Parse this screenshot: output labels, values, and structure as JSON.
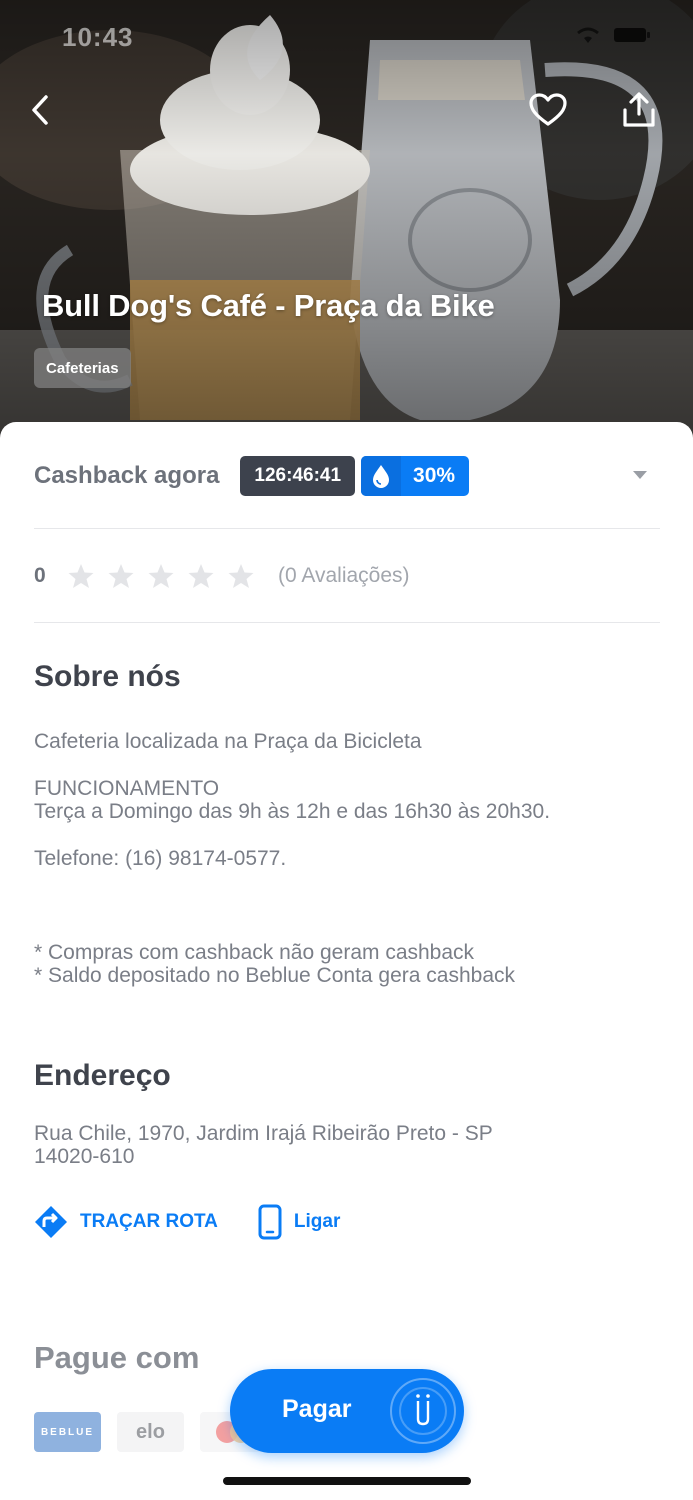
{
  "status_bar": {
    "time": "10:43"
  },
  "header": {
    "back_icon": "chevron-left-icon",
    "favorite_icon": "heart-outline-icon",
    "share_icon": "share-upload-icon",
    "title": "Bull Dog's Café - Praça da Bike",
    "category": "Cafeterias"
  },
  "cashback": {
    "label": "Cashback agora",
    "timer": "126:46:41",
    "percent": "30%",
    "drop_icon": "water-drop-icon",
    "expand_icon": "caret-down-icon"
  },
  "rating": {
    "value": "0",
    "stars_filled": 0,
    "stars_total": 5,
    "reviews": "(0 Avaliações)"
  },
  "about": {
    "title": "Sobre nós",
    "description": "Cafeteria localizada na Praça da Bicicleta",
    "hours": "FUNCIONAMENTO\nTerça a Domingo das 9h às 12h e das 16h30 às 20h30.",
    "phone": "Telefone: (16) 98174-0577.",
    "notes": "* Compras com cashback não geram cashback\n* Saldo depositado no Beblue Conta gera cashback"
  },
  "address": {
    "title": "Endereço",
    "text": "Rua Chile, 1970, Jardim Irajá Ribeirão Preto - SP\n14020-610",
    "route_label": "TRAÇAR ROTA",
    "call_label": "Ligar"
  },
  "payment": {
    "title": "Pague com",
    "methods": [
      "BEBLUE",
      "elo",
      "mastercard"
    ],
    "pay_button_label": "Pagar"
  },
  "colors": {
    "accent": "#0a7cf5",
    "timer_bg": "#3d424d",
    "text_primary": "#3f434c",
    "text_secondary": "#7a7e87"
  }
}
